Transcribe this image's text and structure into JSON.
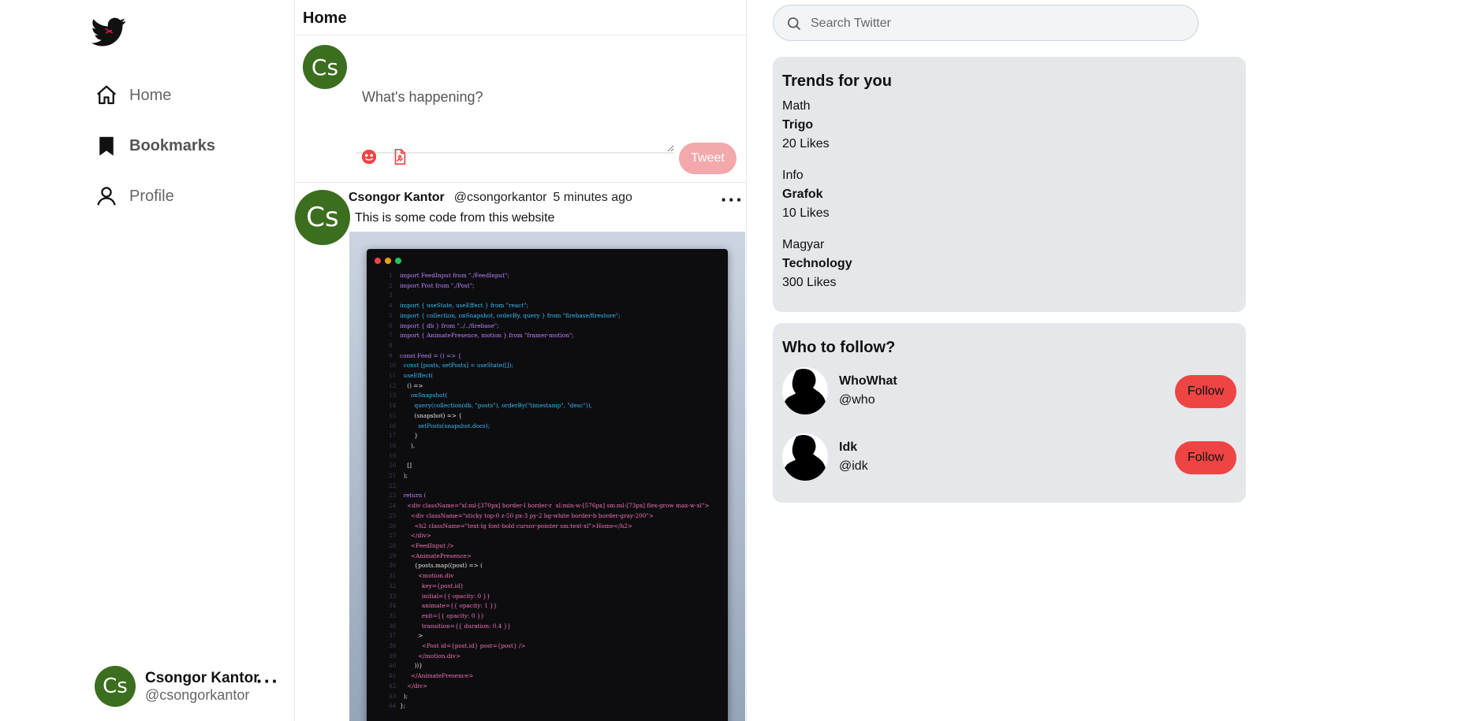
{
  "sidebar": {
    "nav": [
      {
        "label": "Home",
        "icon": "home-icon"
      },
      {
        "label": "Bookmarks",
        "icon": "bookmark-icon"
      },
      {
        "label": "Profile",
        "icon": "user-icon"
      }
    ],
    "user": {
      "initials": "Cs",
      "name": "Csongor Kantor",
      "handle": "@csongorkantor"
    }
  },
  "feed": {
    "title": "Home",
    "composer": {
      "initials": "Cs",
      "placeholder": "What's happening?",
      "tweet_label": "Tweet"
    },
    "post": {
      "initials": "Cs",
      "name": "Csongor Kantor",
      "handle": "@csongorkantor",
      "time": "5 minutes ago",
      "text": "This is some code from this website",
      "code_lines": [
        "import FeedInput from \"./FeedInput\";",
        "import Post from \"./Post\";",
        "",
        "import { useState, useEffect } from \"react\";",
        "import { collection, onSnapshot, orderBy, query } from \"firebase/firestore\";",
        "import { db } from \"../../firebase\";",
        "import { AnimatePresence, motion } from \"framer-motion\";",
        "",
        "const Feed = () => {",
        "  const [posts, setPosts] = useState([]);",
        "  useEffect(",
        "    () =>",
        "      onSnapshot(",
        "        query(collection(db, \"posts\"), orderBy(\"timestamp\", \"desc\")),",
        "        (snapshot) => {",
        "          setPosts(snapshot.docs);",
        "        }",
        "      ),",
        "",
        "    []",
        "  );",
        "",
        "  return (",
        "    <div className=\"xl:ml-[370px] border-l border-r  xl:min-w-[576px] sm:ml-[73px] flex-grow max-w-xl\">",
        "      <div className=\"sticky top-0 z-50 px-3 py-2 bg-white border-b border-gray-200\">",
        "        <h2 className=\"text-lg font-bold cursor-pointer sm:text-xl\">Home</h2>",
        "      </div>",
        "      <FeedInput />",
        "      <AnimatePresence>",
        "        {posts.map((post) => (",
        "          <motion.div",
        "            key={post.id}",
        "            initial={{ opacity: 0 }}",
        "            animate={{ opacity: 1 }}",
        "            exit={{ opacity: 0 }}",
        "            transition={{ duration: 0.4 }}",
        "          >",
        "            <Post id={post.id} post={post} />",
        "          </motion.div>",
        "        ))}",
        "      </AnimatePresence>",
        "    </div>",
        "  );",
        "};"
      ]
    }
  },
  "search": {
    "placeholder": "Search Twitter"
  },
  "trends": {
    "title": "Trends for you",
    "items": [
      {
        "category": "Math",
        "name": "Trigo",
        "likes": "20 Likes"
      },
      {
        "category": "Info",
        "name": "Grafok",
        "likes": "10 Likes"
      },
      {
        "category": "Magyar",
        "name": "Technology",
        "likes": "300 Likes"
      }
    ]
  },
  "who_to_follow": {
    "title": "Who to follow?",
    "users": [
      {
        "name": "WhoWhat",
        "handle": "@who",
        "button": "Follow"
      },
      {
        "name": "Idk",
        "handle": "@idk",
        "button": "Follow"
      }
    ]
  },
  "colors": {
    "accent": "#ef4444",
    "avatar_bg": "#3b6e1e",
    "panel_bg": "#e5e7eb",
    "tweet_disabled": "#f3a8ab"
  }
}
